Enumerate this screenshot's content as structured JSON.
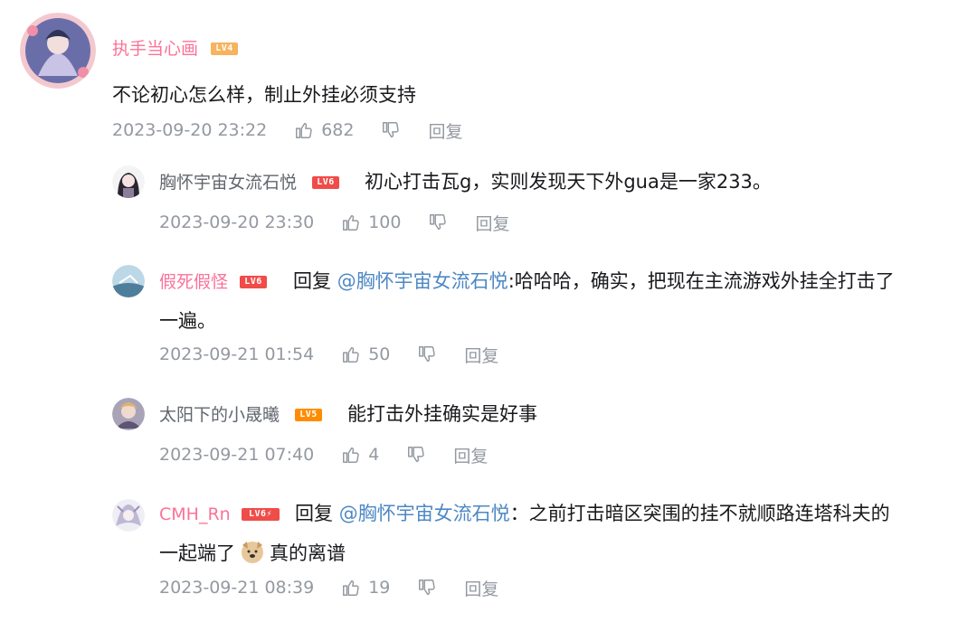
{
  "comments": [
    {
      "username": "执手当心画",
      "level": "LV4",
      "level_color": "#f7b35e",
      "name_color": "#fb7299",
      "content": "不论初心怎么样，制止外挂必须支持",
      "time": "2023-09-20 23:22",
      "likes": "682",
      "reply_label": "回复"
    },
    {
      "username": "胸怀宇宙女流石悦",
      "level": "LV6",
      "level_color": "#f04c49",
      "name_color": "#61666d",
      "content": "初心打击瓦g，实则发现天下外gua是一家233。",
      "time": "2023-09-20 23:30",
      "likes": "100",
      "reply_label": "回复"
    },
    {
      "username": "假死假怪",
      "level": "LV6",
      "level_color": "#f04c49",
      "name_color": "#fb7299",
      "reply_prefix": "回复",
      "mention": "@胸怀宇宙女流石悦",
      "content_line1": ":哈哈哈，确实，把现在主流游戏外挂全打击了",
      "content_line2": "一遍。",
      "time": "2023-09-21 01:54",
      "likes": "50",
      "reply_label": "回复"
    },
    {
      "username": "太阳下的小晟曦",
      "level": "LV5",
      "level_color": "#ff8c00",
      "name_color": "#61666d",
      "content": "能打击外挂确实是好事",
      "time": "2023-09-21 07:40",
      "likes": "4",
      "reply_label": "回复"
    },
    {
      "username": "CMH_Rn",
      "level": "LV6⚡",
      "level_color": "#f04c49",
      "name_color": "#fb7299",
      "reply_prefix": "回复",
      "mention": "@胸怀宇宙女流石悦",
      "content_line1": "：之前打击暗区突围的挂不就顺路连塔科夫的",
      "content_line2a": "一起端了",
      "content_line2b": "真的离谱",
      "time": "2023-09-21 08:39",
      "likes": "19",
      "reply_label": "回复"
    }
  ]
}
